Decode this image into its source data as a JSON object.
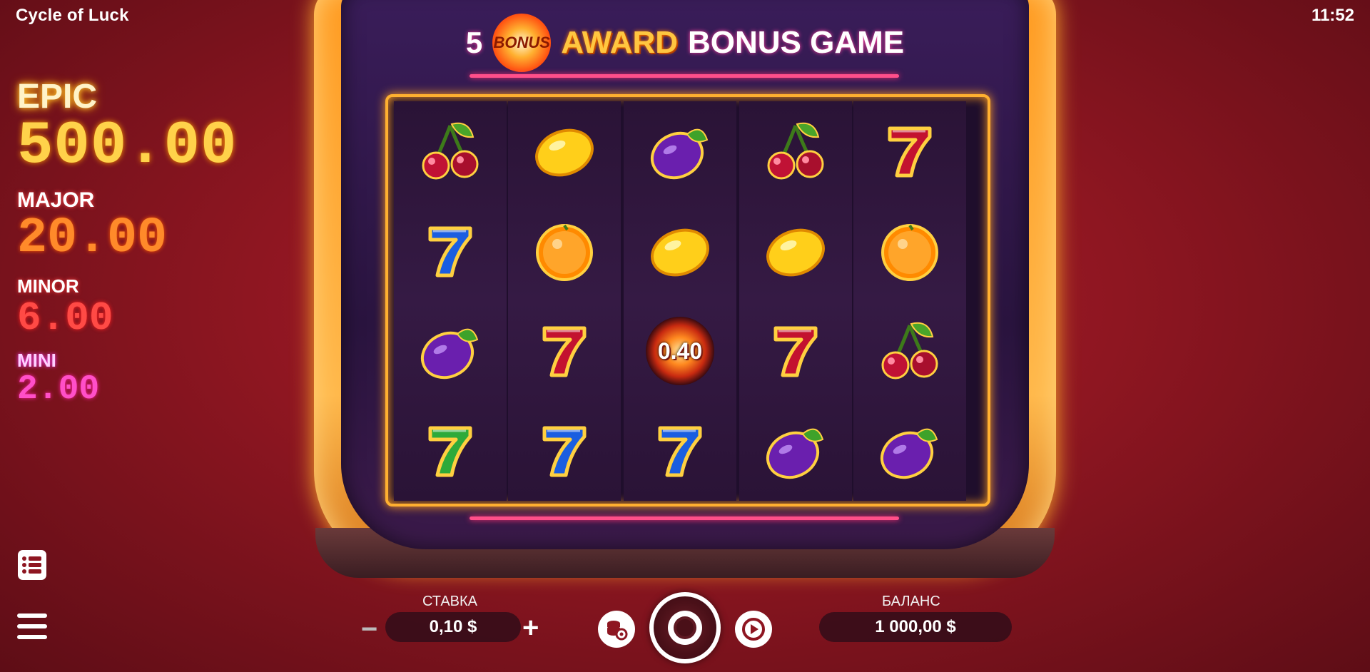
{
  "header": {
    "title": "Cycle of Luck",
    "clock": "11:52"
  },
  "jackpots": [
    {
      "name": "EPIC",
      "value": "500.00"
    },
    {
      "name": "MAJOR",
      "value": "20.00"
    },
    {
      "name": "MINOR",
      "value": "6.00"
    },
    {
      "name": "MINI",
      "value": "2.00"
    }
  ],
  "banner": {
    "count": "5",
    "orb_label": "BONUS",
    "award": "AWARD",
    "rest": "BONUS GAME"
  },
  "reels": [
    [
      "cherry",
      "seven-blue",
      "plum",
      "seven-green"
    ],
    [
      "lemon",
      "orange",
      "seven-red",
      "seven-blue"
    ],
    [
      "plum",
      "lemon",
      "bonus-orb",
      "seven-blue"
    ],
    [
      "cherry",
      "lemon",
      "seven-red",
      "plum"
    ],
    [
      "seven-red",
      "orange",
      "cherry",
      "plum"
    ]
  ],
  "bonus_value": "0.40",
  "controls": {
    "stake_label": "СТАВКА",
    "stake_value": "0,10 $",
    "balance_label": "БАЛАНС",
    "balance_value": "1 000,00 $"
  },
  "icons": {
    "paytable": "list-icon",
    "menu": "hamburger-icon",
    "bet_settings": "coins-gear-icon",
    "spin": "spin-icon",
    "autoplay": "autoplay-icon"
  },
  "colors": {
    "background": "#8e1621",
    "cabinet_glow": "#ffae2a",
    "neon_line": "#ff4f8a",
    "epic": "#ffd24a",
    "major": "#ff8a2a",
    "minor": "#ff4a45",
    "mini": "#ff4fc8"
  }
}
